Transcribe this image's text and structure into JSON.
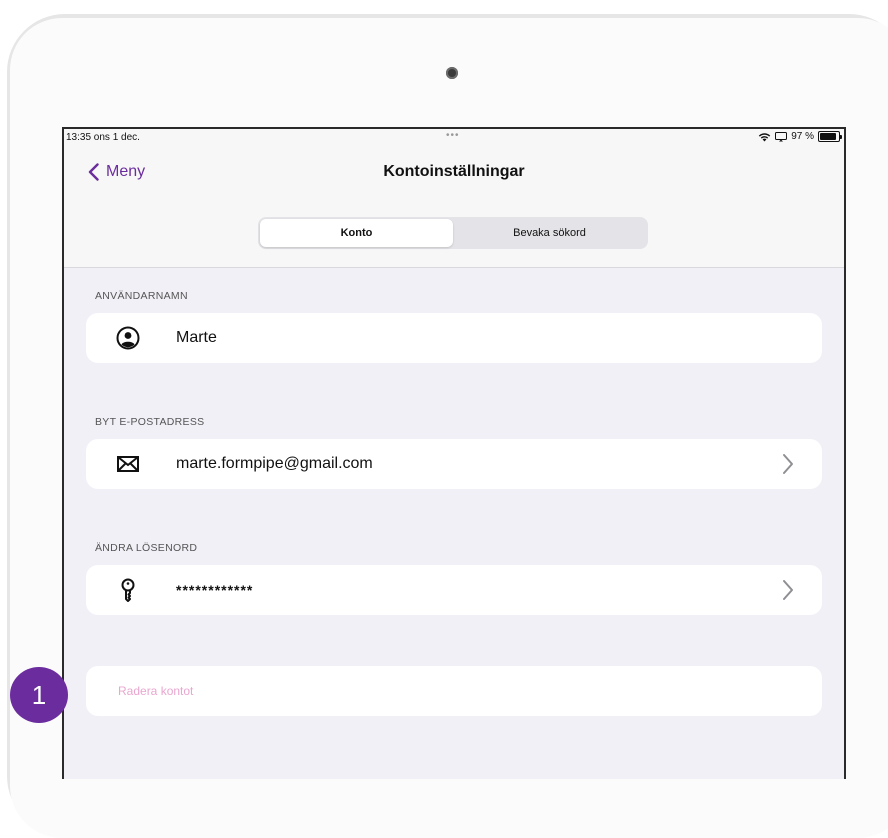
{
  "status_bar": {
    "time": "13:35  ons 1 dec.",
    "dots": "•••",
    "battery_text": "97 %"
  },
  "nav": {
    "back_label": "Meny",
    "title": "Kontoinställningar"
  },
  "segmented_control": {
    "tabs": [
      {
        "label": "Konto",
        "selected": true
      },
      {
        "label": "Bevaka sökord",
        "selected": false
      }
    ]
  },
  "sections": {
    "username": {
      "header": "ANVÄNDARNAMN",
      "value": "Marte"
    },
    "email": {
      "header": "BYT E-POSTADRESS",
      "value": "marte.formpipe@gmail.com"
    },
    "password": {
      "header": "ÄNDRA LÖSENORD",
      "value": "************"
    },
    "delete": {
      "label": "Radera kontot"
    }
  },
  "marker": {
    "number": "1"
  },
  "colors": {
    "accent": "#6b2d9e",
    "delete_text": "#e9a6cf",
    "background": "#f1f0f6"
  },
  "icons": {
    "back": "chevron-left-icon",
    "username": "person-circle-icon",
    "email": "envelope-icon",
    "password": "key-icon",
    "disclosure": "chevron-right-icon"
  }
}
